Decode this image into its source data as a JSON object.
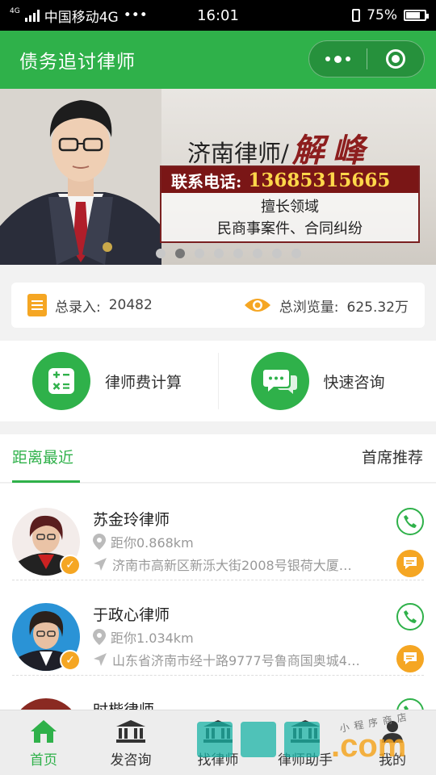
{
  "status_bar": {
    "network": "4G",
    "carrier": "中国移动4G",
    "dots": "•••",
    "time": "16:01",
    "battery_percent": "75%",
    "battery_level": 0.75
  },
  "header": {
    "title": "债务追讨律师"
  },
  "banner": {
    "title_prefix": "济南律师/",
    "name_callig": "解峰",
    "phone_label": "联系电话:",
    "phone_number": "13685315665",
    "specialty_label": "擅长领域",
    "specialty_value": "民商事案件、合同纠纷",
    "page_count": 8,
    "active_page": 1
  },
  "stats": {
    "entries_label": "总录入:",
    "entries_value": "20482",
    "views_label": "总浏览量:",
    "views_value": "625.32万"
  },
  "tools": [
    {
      "label": "律师费计算",
      "icon": "calculator-icon"
    },
    {
      "label": "快速咨询",
      "icon": "chat-bubbles-icon"
    }
  ],
  "tabs": {
    "nearest": "距离最近",
    "recommended": "首席推荐"
  },
  "lawyers": [
    {
      "name": "苏金玲律师",
      "distance": "距你0.868km",
      "address": "济南市高新区新泺大街2008号银荷大厦…"
    },
    {
      "name": "于政心律师",
      "distance": "距你1.034km",
      "address": "山东省济南市经十路9777号鲁商国奥城4…"
    },
    {
      "name": "时楷律师",
      "distance": "",
      "address": ""
    }
  ],
  "tabbar": [
    {
      "label": "首页",
      "icon": "home-icon",
      "active": true
    },
    {
      "label": "发咨询",
      "icon": "library-icon",
      "active": false
    },
    {
      "label": "找律师",
      "icon": "library-icon",
      "active": false
    },
    {
      "label": "律师助手",
      "icon": "library-icon",
      "active": false
    },
    {
      "label": "我的",
      "icon": "person-icon",
      "active": false
    }
  ],
  "watermark": {
    "text": ".com",
    "subtitle": "小程序商店"
  },
  "colors": {
    "brand_green": "#2fb14a",
    "accent_orange": "#f5a623",
    "banner_red": "#7a1616"
  }
}
